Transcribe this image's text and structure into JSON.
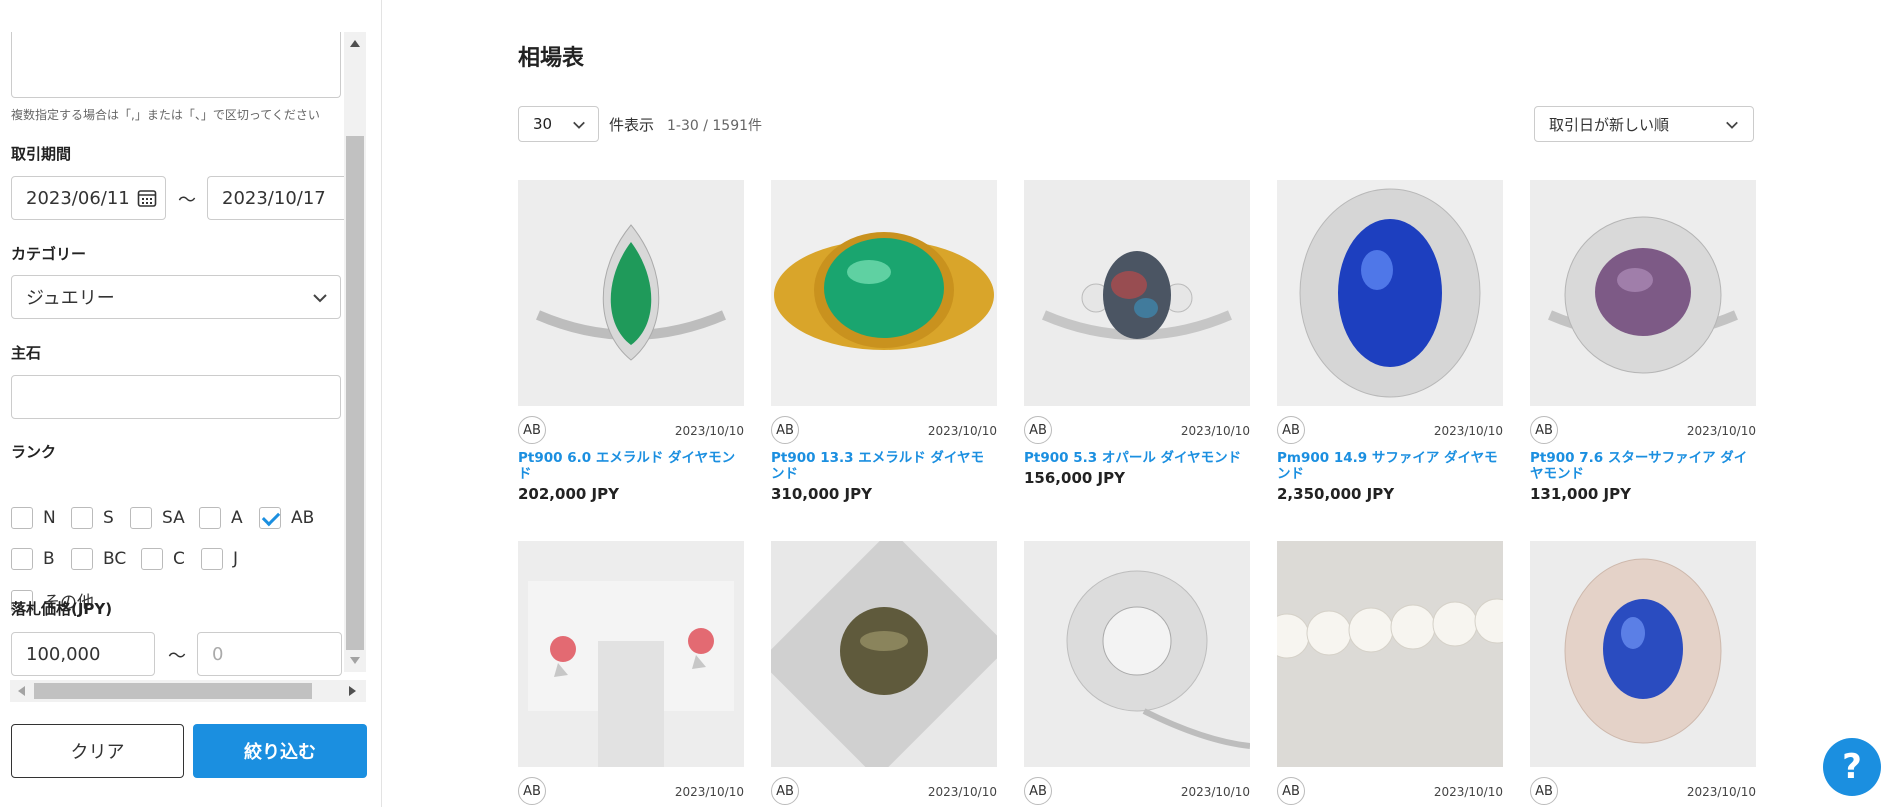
{
  "sidebar": {
    "hint": "複数指定する場合は「,」または「、」で区切ってください",
    "period": {
      "label": "取引期間",
      "from": "2023/06/11",
      "to": "2023/10/17",
      "sep": "～"
    },
    "category": {
      "label": "カテゴリー",
      "value": "ジュエリー"
    },
    "main_stone": {
      "label": "主石",
      "value": ""
    },
    "rank": {
      "label": "ランク",
      "options": [
        {
          "label": "N",
          "checked": false
        },
        {
          "label": "S",
          "checked": false
        },
        {
          "label": "SA",
          "checked": false
        },
        {
          "label": "A",
          "checked": false
        },
        {
          "label": "AB",
          "checked": true
        },
        {
          "label": "B",
          "checked": false
        },
        {
          "label": "BC",
          "checked": false
        },
        {
          "label": "C",
          "checked": false
        },
        {
          "label": "J",
          "checked": false
        },
        {
          "label": "その他",
          "checked": false
        }
      ]
    },
    "price": {
      "label": "落札価格(JPY)",
      "min": "100,000",
      "max_placeholder": "0",
      "sep": "～"
    },
    "clear_label": "クリア",
    "filter_label": "絞り込む"
  },
  "main": {
    "title": "相場表",
    "per_page": "30",
    "per_page_label": "件表示",
    "count": "1-30 / 1591件",
    "sort": "取引日が新しい順"
  },
  "items": [
    {
      "rank": "AB",
      "date": "2023/10/10",
      "name": "Pt900 6.0 エメラルド ダイヤモンド",
      "price": "202,000 JPY",
      "image": "emerald-pear-ring"
    },
    {
      "rank": "AB",
      "date": "2023/10/10",
      "name": "Pt900 13.3 エメラルド ダイヤモンド",
      "price": "310,000 JPY",
      "image": "emerald-cabochon-gold-ring"
    },
    {
      "rank": "AB",
      "date": "2023/10/10",
      "name": "Pt900 5.3 オパール ダイヤモンド",
      "price": "156,000 JPY",
      "image": "opal-ring"
    },
    {
      "rank": "AB",
      "date": "2023/10/10",
      "name": "Pm900 14.9 サファイア ダイヤモンド",
      "price": "2,350,000 JPY",
      "image": "sapphire-ballerina-ring"
    },
    {
      "rank": "AB",
      "date": "2023/10/10",
      "name": "Pt900 7.6 スターサファイア ダイヤモンド",
      "price": "131,000 JPY",
      "image": "star-sapphire-ring"
    },
    {
      "rank": "AB",
      "date": "2023/10/10",
      "image": "conch-pearl-earrings"
    },
    {
      "rank": "AB",
      "date": "2023/10/10",
      "image": "cats-eye-ring"
    },
    {
      "rank": "AB",
      "date": "2023/10/10",
      "image": "diamond-flower-pendant"
    },
    {
      "rank": "AB",
      "date": "2023/10/10",
      "image": "pearl-necklace"
    },
    {
      "rank": "AB",
      "date": "2023/10/10",
      "image": "sapphire-halo-ring"
    }
  ],
  "help_label": "?",
  "colors": {
    "accent": "#1b8fe0"
  }
}
